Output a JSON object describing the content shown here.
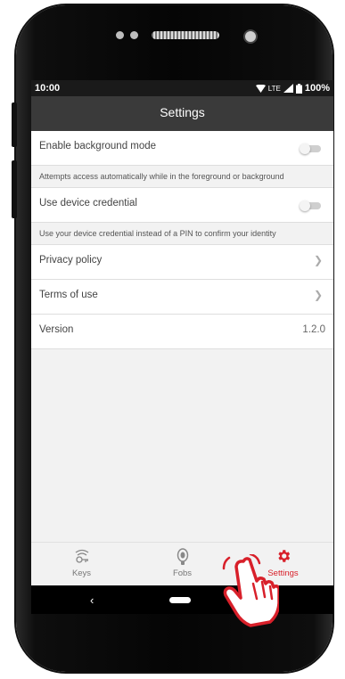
{
  "status_bar": {
    "time": "10:00",
    "network": "LTE",
    "battery": "100%"
  },
  "app_bar": {
    "title": "Settings"
  },
  "settings": {
    "background_mode": {
      "label": "Enable background mode",
      "enabled": false,
      "description": "Attempts access automatically while in the foreground or background"
    },
    "device_credential": {
      "label": "Use device credential",
      "enabled": false,
      "description": "Use your device credential instead of a PIN to confirm your identity"
    },
    "privacy_policy": {
      "label": "Privacy policy"
    },
    "terms_of_use": {
      "label": "Terms of use"
    },
    "version": {
      "label": "Version",
      "value": "1.2.0"
    }
  },
  "bottom_nav": {
    "items": [
      {
        "label": "Keys",
        "icon": "key-icon"
      },
      {
        "label": "Fobs",
        "icon": "fob-icon"
      },
      {
        "label": "Settings",
        "icon": "gear-icon",
        "active": true
      }
    ]
  },
  "colors": {
    "accent": "#d8202a",
    "app_bar": "#3a3a3a",
    "background": "#f2f2f2"
  }
}
